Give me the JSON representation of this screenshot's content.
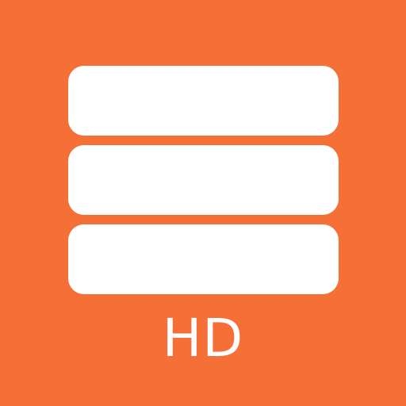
{
  "app_icon": {
    "icon_name": "stacked-layers-icon",
    "badge_text": "HD",
    "colors": {
      "background": "#f47036",
      "foreground": "#ffffff"
    },
    "bars": [
      {
        "name": "bar-1"
      },
      {
        "name": "bar-2"
      },
      {
        "name": "bar-3"
      }
    ]
  }
}
